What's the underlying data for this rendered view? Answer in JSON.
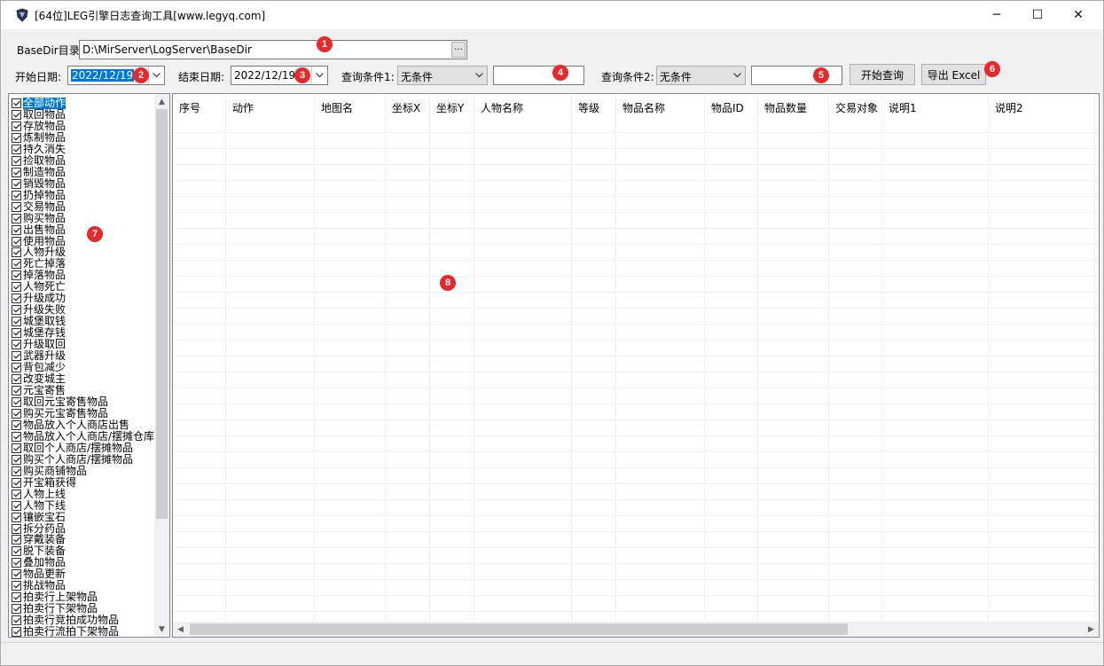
{
  "window": {
    "title": "[64位]LEG引擎日志查询工具[www.legyq.com]",
    "minimize_glyph": "─",
    "maximize_glyph": "☐",
    "close_glyph": "✕"
  },
  "form": {
    "basedir_label": "BaseDir目录:",
    "basedir_value": "D:\\MirServer\\LogServer\\BaseDir",
    "browse_label": "...",
    "start_label": "开始日期:",
    "start_value": "2022/12/19",
    "end_label": "结束日期:",
    "end_value": "2022/12/19",
    "cond1_label": "查询条件1:",
    "cond1_value": "无条件",
    "cond1_input": "",
    "cond2_label": "查询条件2:",
    "cond2_value": "无条件",
    "cond2_input": "",
    "query_button": "开始查询",
    "export_button": "导出 Excel"
  },
  "markers": [
    "1",
    "2",
    "3",
    "4",
    "5",
    "6",
    "7",
    "8"
  ],
  "actions": [
    "全部动作",
    "取回物品",
    "存放物品",
    "炼制物品",
    "持久消失",
    "捡取物品",
    "制造物品",
    "销毁物品",
    "扔掉物品",
    "交易物品",
    "购买物品",
    "出售物品",
    "使用物品",
    "人物升级",
    "死亡掉落",
    "掉落物品",
    "人物死亡",
    "升级成功",
    "升级失败",
    "城堡取钱",
    "城堡存钱",
    "升级取回",
    "武器升级",
    "背包减少",
    "改变城主",
    "元宝寄售",
    "取回元宝寄售物品",
    "购买元宝寄售物品",
    "物品放入个人商店出售",
    "物品放入个人商店/摆摊仓库",
    "取回个人商店/摆摊物品",
    "购买个人商店/摆摊物品",
    "购买商铺物品",
    "开宝箱获得",
    "人物上线",
    "人物下线",
    "镶嵌宝石",
    "拆分药品",
    "穿戴装备",
    "脱下装备",
    "叠加物品",
    "物品更新",
    "挑战物品",
    "拍卖行上架物品",
    "拍卖行下架物品",
    "拍卖行竞拍成功物品",
    "拍卖行流拍下架物品"
  ],
  "grid": {
    "columns": [
      "序号",
      "动作",
      "地图名",
      "坐标X",
      "坐标Y",
      "人物名称",
      "等级",
      "物品名称",
      "物品ID",
      "物品数量",
      "交易对象",
      "说明1",
      "说明2"
    ],
    "rows": []
  },
  "icons": {
    "app": "leg-shield-icon",
    "dropdown": "chevron-down-icon",
    "scroll_up": "▲",
    "scroll_down": "▼",
    "scroll_left": "◀",
    "scroll_right": "▶"
  },
  "colors": {
    "selection": "#0078d7",
    "marker": "#e8282a"
  }
}
